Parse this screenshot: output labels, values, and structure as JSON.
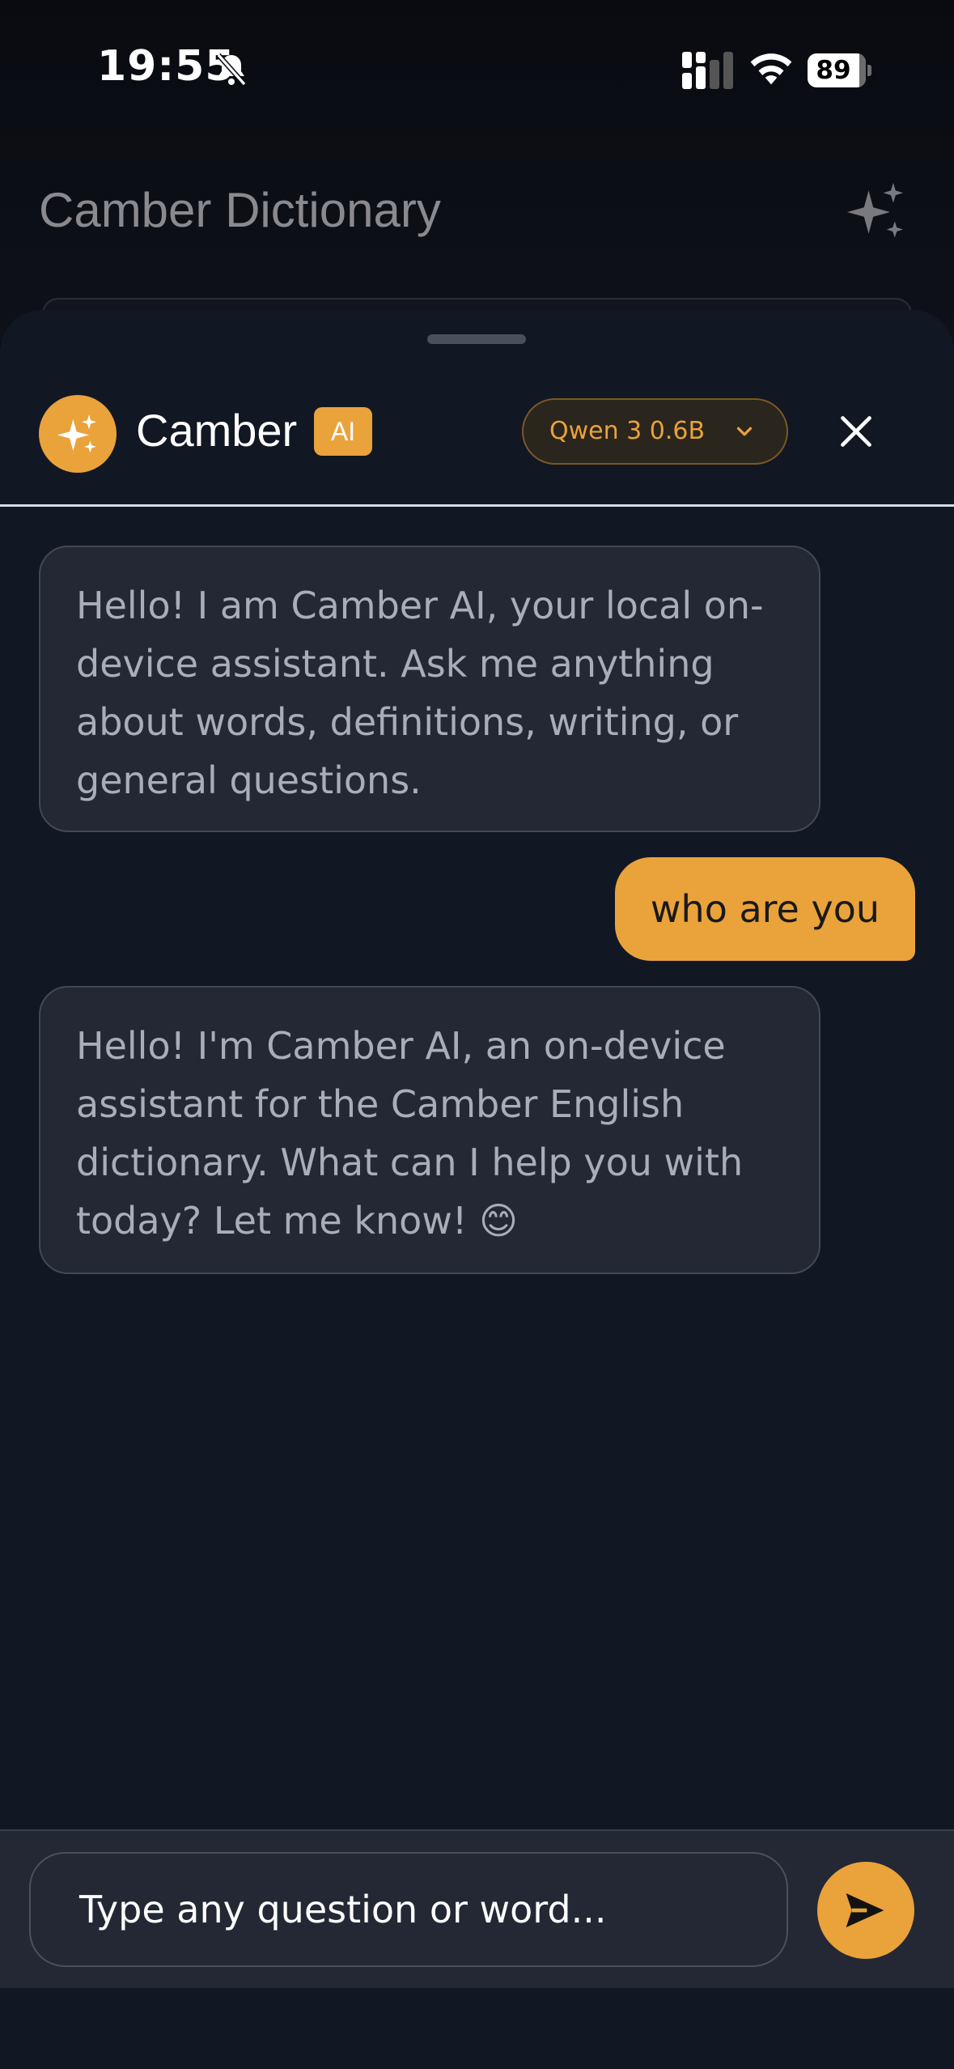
{
  "status_bar": {
    "time": "19:55",
    "battery": "89"
  },
  "background_app": {
    "title": "Camber Dictionary"
  },
  "chat_header": {
    "name": "Camber",
    "tag": "AI",
    "model": "Qwen 3 0.6B"
  },
  "messages": [
    {
      "role": "assistant",
      "text": "Hello! I am Camber AI, your local on-device assistant. Ask me anything about words, definitions, writing, or general questions."
    },
    {
      "role": "user",
      "text": "who are you"
    },
    {
      "role": "assistant",
      "text": "Hello! I'm Camber AI, an on-device assistant for the Camber English dictionary. What can I help you with today? Let me know! 😊"
    }
  ],
  "composer": {
    "placeholder": "Type any question or word..."
  },
  "colors": {
    "accent": "#eaa23b",
    "sheet": "#121724",
    "bubble": "#232834"
  },
  "icons": [
    "bell-slash-icon",
    "signal-icon",
    "wifi-icon",
    "sparkles-icon",
    "chevron-down-icon",
    "close-icon",
    "send-icon"
  ]
}
